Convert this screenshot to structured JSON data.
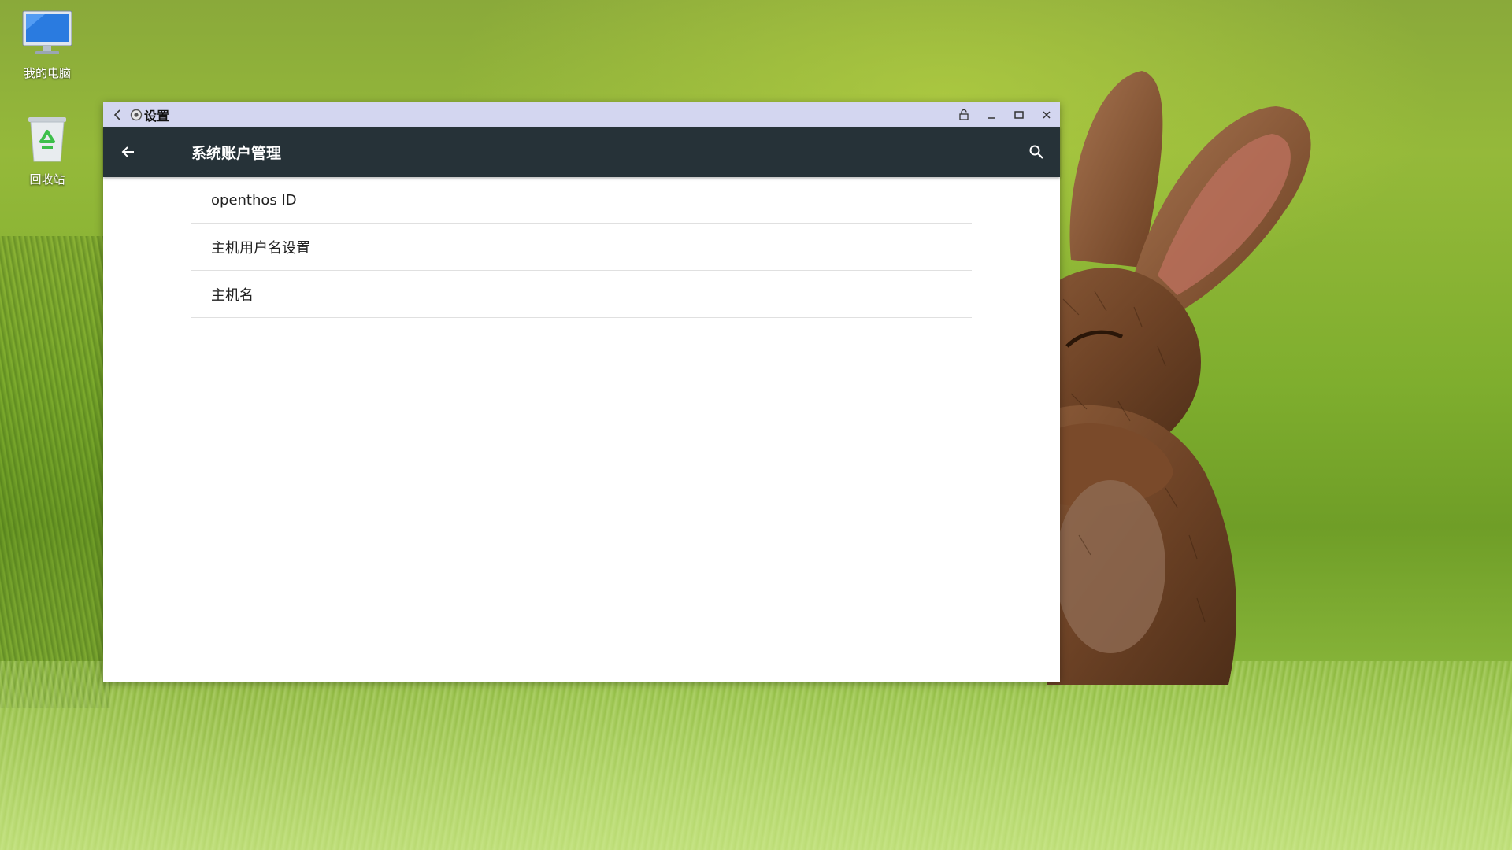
{
  "desktop": {
    "icons": [
      {
        "label": "我的电脑",
        "icon": "computer-icon"
      },
      {
        "label": "回收站",
        "icon": "recycle-bin-icon"
      }
    ]
  },
  "window": {
    "title": "设置",
    "app_icon": "settings-gear-icon",
    "controls": [
      "unlock-icon",
      "minimize-icon",
      "maximize-icon",
      "close-icon"
    ]
  },
  "appbar": {
    "title": "系统账户管理",
    "back_icon": "arrow-back-icon",
    "search_icon": "search-icon",
    "color": "#263238"
  },
  "list": {
    "items": [
      {
        "label": "openthos ID"
      },
      {
        "label": "主机用户名设置"
      },
      {
        "label": "主机名"
      }
    ]
  }
}
